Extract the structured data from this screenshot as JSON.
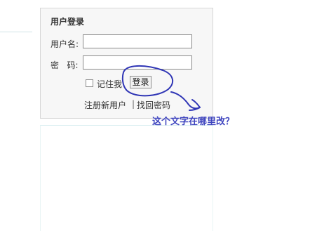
{
  "login": {
    "title": "用户登录",
    "username_label": "用户名:",
    "password_label": "密   码:",
    "username_value": "",
    "password_value": "",
    "remember_label": "记住我",
    "login_button": "登录",
    "register_link": "注册新用户",
    "separator": "|",
    "forgot_link": "找回密码"
  },
  "annotation": {
    "question": "这个文字在哪里改？",
    "color": "#3f45bf"
  }
}
